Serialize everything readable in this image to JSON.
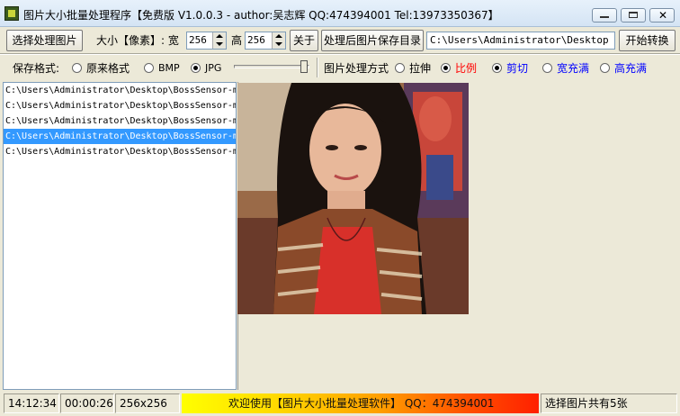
{
  "window": {
    "title": "图片大小批量处理程序【免费版 V1.0.0.3 - author:吴志辉  QQ:474394001 Tel:13973350367】",
    "close_glyph": "✕"
  },
  "toolbar": {
    "select_images_label": "选择处理图片",
    "size_label": "大小【像素】: 宽",
    "width_value": "256",
    "height_label": "高",
    "height_value": "256",
    "about_label": "关于",
    "output_dir_button": "处理后图片保存目录",
    "output_dir_value": "C:\\Users\\Administrator\\Desktop",
    "start_button": "开始转换"
  },
  "options": {
    "save_format_label": "保存格式:",
    "format_options": [
      {
        "label": "原来格式",
        "selected": false
      },
      {
        "label": "BMP",
        "selected": false
      },
      {
        "label": "JPG",
        "selected": true
      }
    ],
    "quality_level": 0.97,
    "process_mode_label": "图片处理方式",
    "mode_options": [
      {
        "label": "拉伸",
        "selected": false,
        "color": "#000000"
      },
      {
        "label": "比例",
        "selected": true,
        "color": "#ff0000"
      },
      {
        "label": "剪切",
        "selected": true,
        "color": "#0000ff"
      },
      {
        "label": "宽充满",
        "selected": false,
        "color": "#0000ff"
      },
      {
        "label": "高充满",
        "selected": false,
        "color": "#0000ff"
      }
    ]
  },
  "file_list": {
    "items": [
      {
        "path": "C:\\Users\\Administrator\\Desktop\\BossSensor-m",
        "selected": false
      },
      {
        "path": "C:\\Users\\Administrator\\Desktop\\BossSensor-m",
        "selected": false
      },
      {
        "path": "C:\\Users\\Administrator\\Desktop\\BossSensor-m",
        "selected": false
      },
      {
        "path": "C:\\Users\\Administrator\\Desktop\\BossSensor-m",
        "selected": true
      },
      {
        "path": "C:\\Users\\Administrator\\Desktop\\BossSensor-m",
        "selected": false
      }
    ]
  },
  "status": {
    "time": "14:12:34",
    "elapsed": "00:00:26",
    "dimensions": "256x256",
    "marquee": "欢迎使用【图片大小批量处理软件】 QQ：474394001",
    "count": "选择图片共有5张"
  },
  "colors": {
    "accent_selection": "#3399ff",
    "window_bg": "#ece9d8"
  }
}
